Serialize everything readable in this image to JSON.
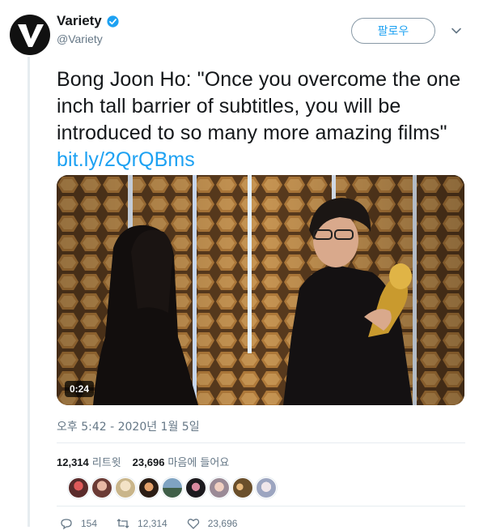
{
  "user": {
    "display_name": "Variety",
    "handle": "@Variety"
  },
  "follow_label": "팔로우",
  "tweet": {
    "text": "Bong Joon Ho: \"Once you overcome the one inch tall barrier of subtitles, you will be introduced to so many more amazing films\"",
    "link": "bit.ly/2QrQBms"
  },
  "media": {
    "duration": "0:24"
  },
  "timestamp": "오후 5:42 - 2020년 1월 5일",
  "stats": {
    "retweets_count": "12,314",
    "retweets_label": "리트윗",
    "likes_count": "23,696",
    "likes_label": "마음에 들어요"
  },
  "actions": {
    "replies": "154",
    "retweets": "12,314",
    "likes": "23,696"
  },
  "colors": {
    "accent": "#1da1f2",
    "muted": "#657786",
    "border": "#e6ecf0"
  }
}
